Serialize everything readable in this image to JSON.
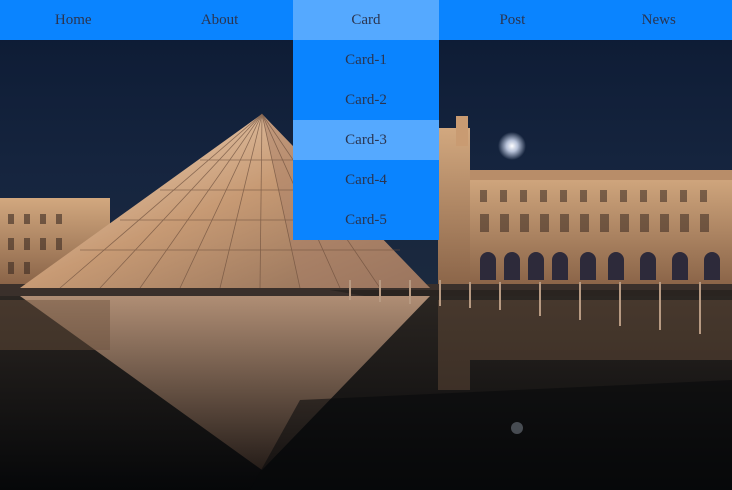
{
  "colors": {
    "nav_bg": "#0a84ff",
    "nav_active_bg": "#55a9ff",
    "dropdown_bg": "#0a84ff",
    "dropdown_hover_bg": "#55a9ff",
    "text": "#2b3550"
  },
  "nav": {
    "items": [
      {
        "label": "Home"
      },
      {
        "label": "About"
      },
      {
        "label": "Card"
      },
      {
        "label": "Post"
      },
      {
        "label": "News"
      }
    ],
    "active_index": 2
  },
  "dropdown": {
    "items": [
      {
        "label": "Card-1"
      },
      {
        "label": "Card-2"
      },
      {
        "label": "Card-3"
      },
      {
        "label": "Card-4"
      },
      {
        "label": "Card-5"
      }
    ],
    "highlighted_index": 2
  },
  "background": {
    "subject": "illuminated glass pyramid and palace at night"
  }
}
